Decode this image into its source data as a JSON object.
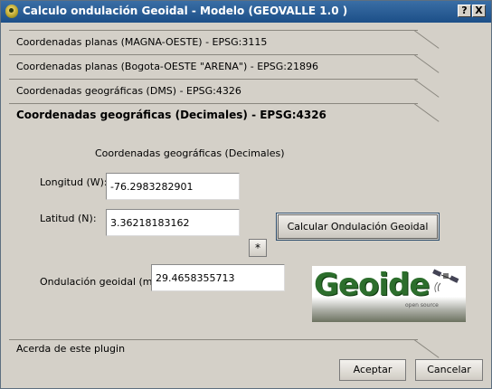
{
  "window": {
    "title": "Calculo ondulación Geoidal - Modelo (GEOVALLE 1.0 )",
    "help_label": "?",
    "close_label": "X"
  },
  "sections": [
    {
      "label": "Coordenadas planas (MAGNA-OESTE) - EPSG:3115",
      "active": false
    },
    {
      "label": "Coordenadas planas (Bogota-OESTE \"ARENA\") - EPSG:21896",
      "active": false
    },
    {
      "label": "Coordenadas geográficas (DMS) - EPSG:4326",
      "active": false
    },
    {
      "label": "Coordenadas geográficas (Decimales)  - EPSG:4326",
      "active": true
    }
  ],
  "form": {
    "page_title": "Coordenadas geográficas (Decimales)",
    "longitud_label": "Longitud (W):",
    "longitud_value": "-76.2983282901",
    "latitud_label": "Latitud (N):",
    "latitud_value": "3.36218183162",
    "star_label": "*",
    "ondulacion_label": "Ondulación geoidal (m):",
    "ondulacion_value": "29.4658355713",
    "calc_button": "Calcular Ondulación Geoidal"
  },
  "logo": {
    "text": "Geoide",
    "subtext": "open source"
  },
  "about_label": "Acerda de este plugin",
  "buttons": {
    "accept": "Aceptar",
    "cancel": "Cancelar"
  }
}
